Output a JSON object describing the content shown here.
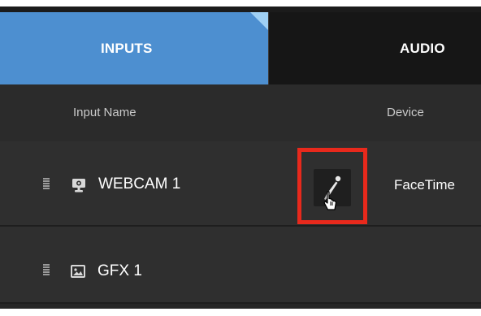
{
  "tabs": [
    {
      "label": "INPUTS",
      "active": true
    },
    {
      "label": "AUDIO",
      "active": false
    }
  ],
  "table": {
    "columns": {
      "name": "Input Name",
      "device": "Device"
    },
    "rows": [
      {
        "name": "WEBCAM 1",
        "device": "FaceTime",
        "icon": "webcam-icon",
        "has_mic_button": true
      },
      {
        "name": "GFX 1",
        "device": "",
        "icon": "image-icon",
        "has_mic_button": false
      }
    ]
  },
  "colors": {
    "active_tab": "#4d8fd0",
    "tab_corner": "#9fd0f4",
    "highlight": "#e8291c",
    "panel_bg": "#232323",
    "row_bg": "#2f2f2f"
  }
}
